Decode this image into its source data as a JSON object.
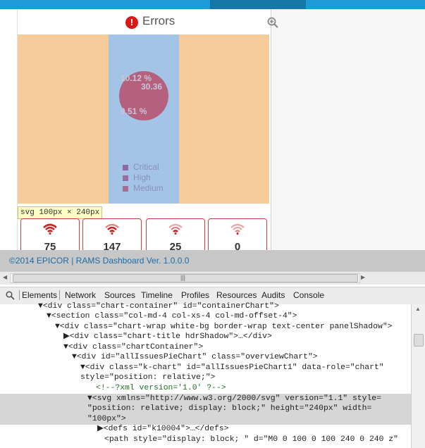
{
  "dashboard": {
    "panel_title": "Errors",
    "pie_labels": [
      "10.12 %",
      "30.36",
      "9.51 %"
    ],
    "legend": [
      {
        "label": "Critical",
        "color": "#8c6aa4"
      },
      {
        "label": "High",
        "color": "#9a6e9c"
      },
      {
        "label": "Medium",
        "color": "#a76f92"
      }
    ],
    "inspect_tooltip": "svg 100px × 240px",
    "counts": [
      "75",
      "147",
      "25",
      "0"
    ],
    "footer_text": "©2014 EPICOR | RAMS Dashboard Ver. 1.0.0.0"
  },
  "devtools": {
    "tabs": [
      "Elements",
      "Network",
      "Sources",
      "Timeline",
      "Profiles",
      "Resources",
      "Audits",
      "Console"
    ],
    "active_tab": "Elements",
    "lines": [
      "▼<div class=\"chart-container\" id=\"containerChart\">",
      "▼<section class=\"col-md-4 col-xs-4 col-md-offset-4\">",
      "▼<div class=\"chart-wrap white-bg border-wrap text-center panelShadow\">",
      "▶<div class=\"chart-title hdrShadow\">…</div>",
      "▼<div class=\"chartContainer\">",
      "▼<div id=\"allIssuesPieChart\" class=\"overviewChart\">",
      "▼<div class=\"k-chart\" id=\"allIssuesPieChart1\" data-role=\"chart\"",
      "style=\"position: relative;\">",
      "<!--?xml version='1.0' ?-->",
      "▼<svg xmlns=\"http://www.w3.org/2000/svg\" version=\"1.1\" style=",
      "\"position: relative; display: block;\" height=\"240px\" width=",
      "\"100px\">",
      "▶<defs id=\"k10004\">…</defs>",
      "<path style=\"display: block; \" d=\"M0 0 100 0 100 240 0 240 z\""
    ]
  },
  "colors": {
    "topbar": "#1e9bd7",
    "chart_background": "#f6cc9b",
    "svg_highlight": "#a3c4e6",
    "pie": "#b5607c",
    "card_border": "#c84242",
    "footer_text": "#1c6da8"
  }
}
